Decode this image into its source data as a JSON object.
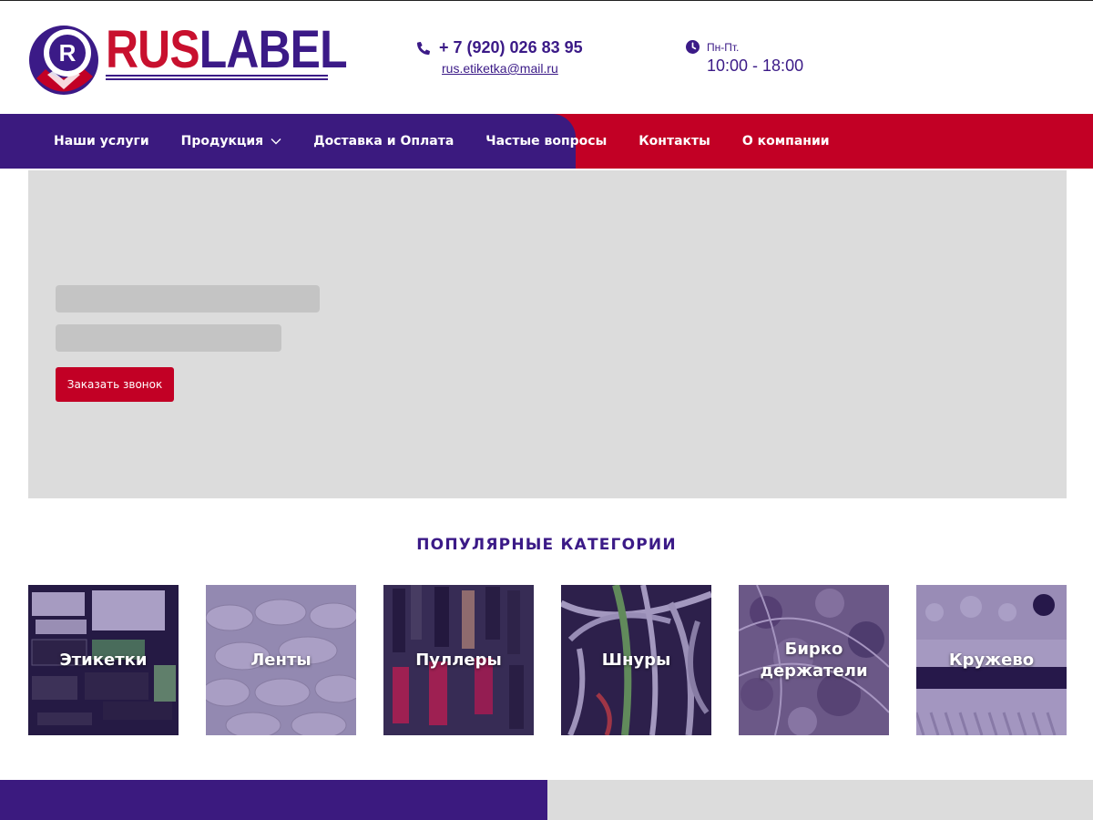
{
  "brand": {
    "logo_part1": "RUS",
    "logo_part2": "LABEL",
    "logo_badge_letter": "R",
    "colors": {
      "purple": "#3b1a87",
      "red": "#c20025"
    }
  },
  "header": {
    "phone": "+ 7 (920) 026 83 95",
    "phone_icon": "phone-icon",
    "email": "rus.etiketka@mail.ru",
    "hours_label": "Пн-Пт.",
    "hours_value": "10:00 - 18:00",
    "hours_icon": "clock-icon"
  },
  "nav": {
    "items": [
      {
        "label": "Наши услуги"
      },
      {
        "label": "Продукция",
        "has_dropdown": true
      },
      {
        "label": "Доставка и Оплата"
      },
      {
        "label": "Частые вопросы"
      },
      {
        "label": "Контакты"
      },
      {
        "label": "О компании"
      }
    ]
  },
  "hero": {
    "cta_label": "Заказать звонок"
  },
  "categories": {
    "title": "ПОПУЛЯРНЫЕ КАТЕГОРИИ",
    "items": [
      {
        "label": "Этикетки"
      },
      {
        "label": "Ленты"
      },
      {
        "label": "Пуллеры"
      },
      {
        "label": "Шнуры"
      },
      {
        "label": "Бирко держатели"
      },
      {
        "label": "Кружево"
      }
    ]
  }
}
